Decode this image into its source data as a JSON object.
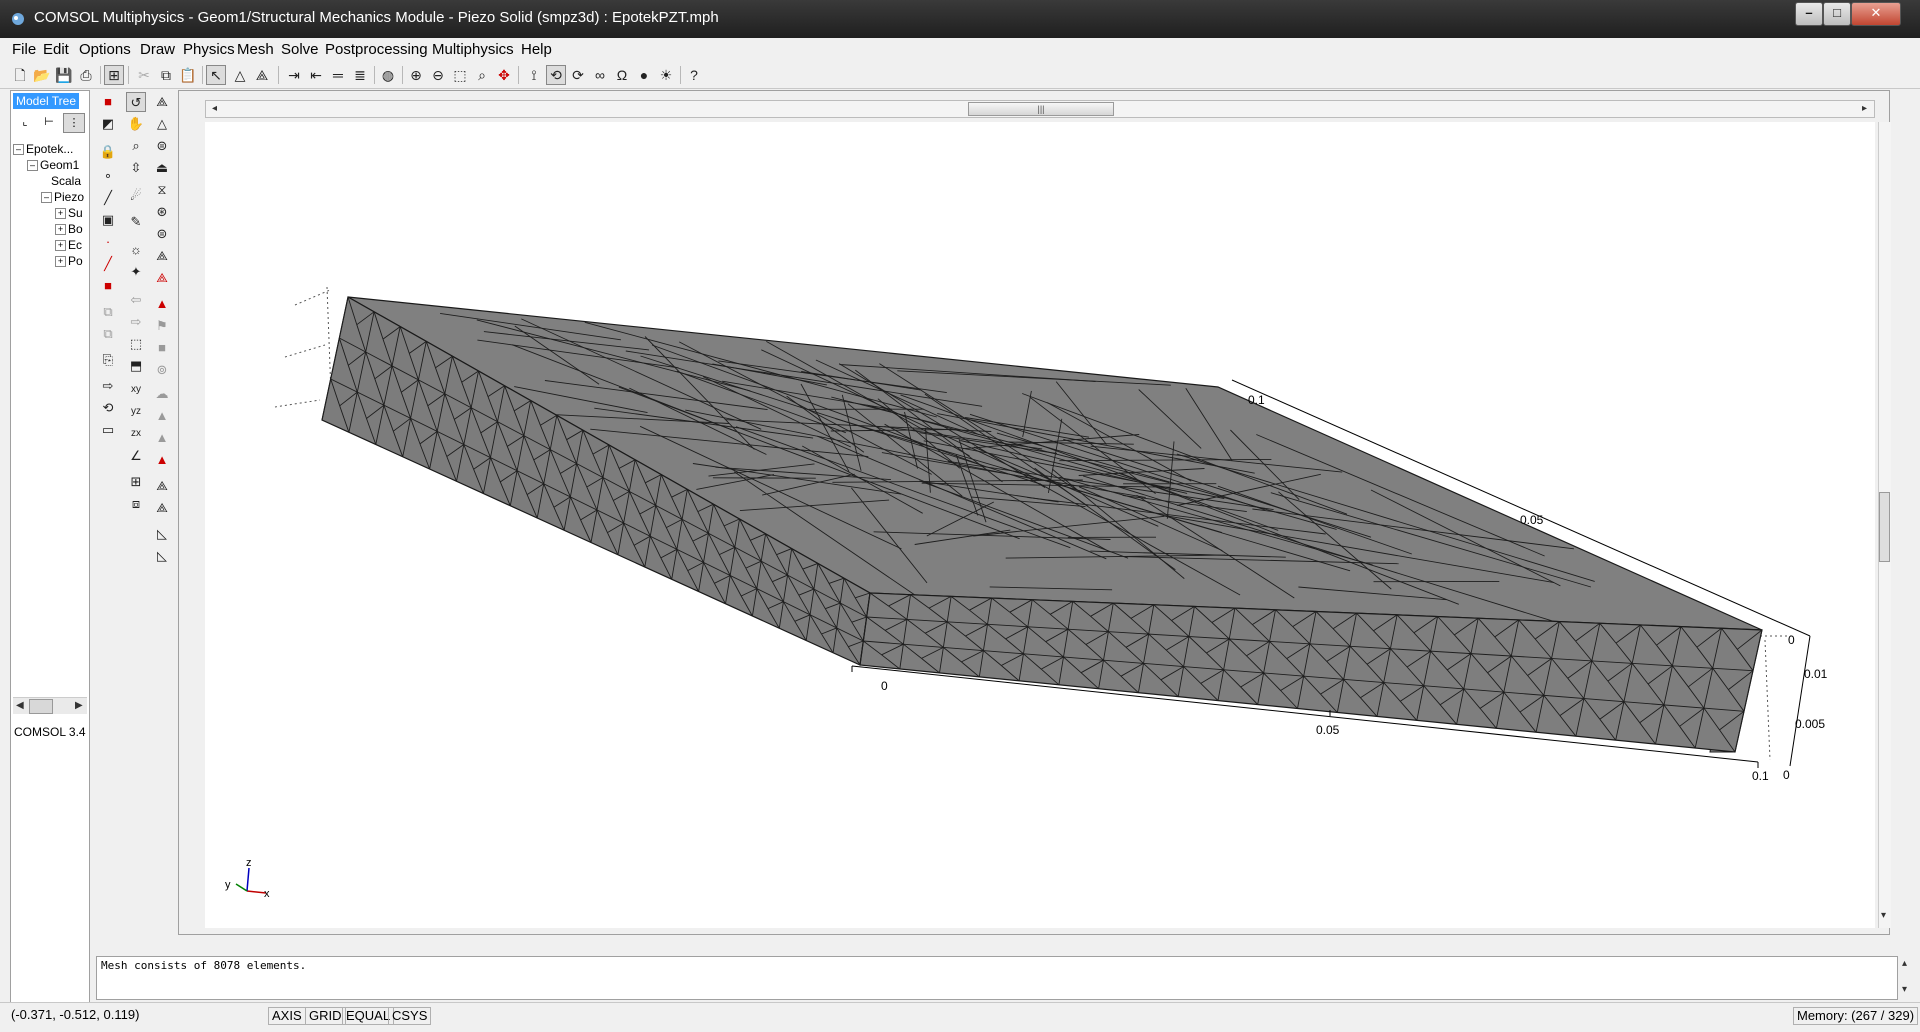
{
  "window": {
    "title": "COMSOL Multiphysics - Geom1/Structural Mechanics Module - Piezo Solid (smpz3d) : EpotekPZT.mph",
    "minimize": "–",
    "maximize": "□",
    "close": "✕"
  },
  "menu": [
    "File",
    "Edit",
    "Options",
    "Draw",
    "Physics",
    "Mesh",
    "Solve",
    "Postprocessing",
    "Multiphysics",
    "Help"
  ],
  "tree": {
    "header": "Model Tree",
    "items": [
      {
        "label": "Epotek...",
        "expander": "–"
      },
      {
        "label": "Geom1",
        "expander": "–"
      },
      {
        "label": "Scala",
        "expander": ""
      },
      {
        "label": "Piezo",
        "expander": "–"
      },
      {
        "label": "Su",
        "expander": "+"
      },
      {
        "label": "Bo",
        "expander": "+"
      },
      {
        "label": "Ec",
        "expander": "+"
      },
      {
        "label": "Po",
        "expander": "+"
      }
    ],
    "version": "COMSOL 3.4"
  },
  "axes": {
    "y_top": [
      "0.1",
      "0.05",
      "0"
    ],
    "x_bottom": [
      "0",
      "0.05",
      "0.1"
    ],
    "z_right": [
      "0.01",
      "0.005",
      "0"
    ],
    "triad": {
      "x": "x",
      "y": "y",
      "z": "z"
    }
  },
  "message": "Mesh consists of 8078 elements.",
  "status": {
    "coords": "(-0.371, -0.512, 0.119)",
    "axis": "AXIS",
    "grid": "GRID",
    "equal": "EQUAL",
    "csys": "CSYS",
    "memory": "Memory: (267 / 329)"
  },
  "colors": {
    "mesh_fill": "#808080",
    "mesh_edge": "#1a1a1a"
  }
}
